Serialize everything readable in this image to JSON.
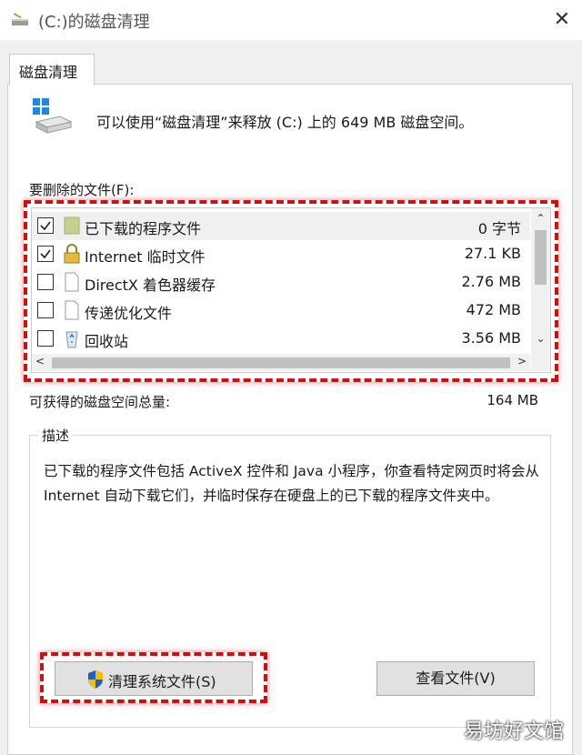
{
  "window": {
    "title": "(C:)的磁盘清理",
    "close_glyph": "✕"
  },
  "tab": {
    "label": "磁盘清理"
  },
  "intro": "可以使用“磁盘清理”来释放  (C:) 上的 649 MB 磁盘空间。",
  "files_label": "要删除的文件(F):",
  "files": [
    {
      "name": "已下载的程序文件",
      "size": "0 字节",
      "checked": true,
      "icon": "folder-icon"
    },
    {
      "name": "Internet 临时文件",
      "size": "27.1 KB",
      "checked": true,
      "icon": "lock-icon"
    },
    {
      "name": "DirectX 着色器缓存",
      "size": "2.76 MB",
      "checked": false,
      "icon": "document-icon"
    },
    {
      "name": "传递优化文件",
      "size": "472 MB",
      "checked": false,
      "icon": "document-icon"
    },
    {
      "name": "回收站",
      "size": "3.56 MB",
      "checked": false,
      "icon": "recycle-bin-icon"
    }
  ],
  "total_label": "可获得的磁盘空间总量:",
  "total_value": "164 MB",
  "description": {
    "title": "描述",
    "text": "已下载的程序文件包括 ActiveX 控件和 Java 小程序，你查看特定网页时将会从 Internet 自动下载它们，并临时保存在硬盘上的已下载的程序文件夹中。"
  },
  "buttons": {
    "clean_system": "清理系统文件(S)",
    "view_files": "查看文件(V)"
  },
  "watermark": "易坊好文馆",
  "colors": {
    "highlight": "#d01010",
    "shield_blue": "#1f5fbf",
    "shield_yellow": "#f2c200"
  }
}
